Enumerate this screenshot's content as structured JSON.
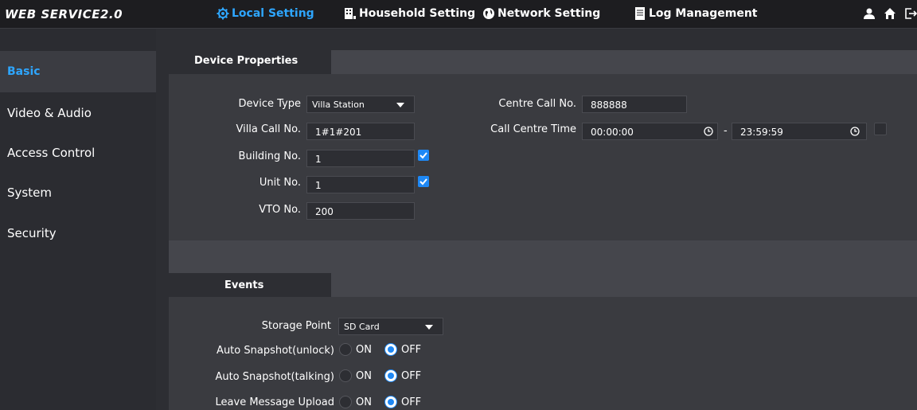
{
  "app": {
    "title": "WEB SERVICE2.0"
  },
  "nav": {
    "items": [
      {
        "label": "Local Setting",
        "icon": "gear-icon",
        "active": true
      },
      {
        "label": "Household Setting",
        "icon": "household-icon",
        "active": false
      },
      {
        "label": "Network Setting",
        "icon": "globe-icon",
        "active": false
      },
      {
        "label": "Log Management",
        "icon": "log-icon",
        "active": false
      }
    ],
    "right_icons": [
      "user-icon",
      "home-icon",
      "logout-icon"
    ]
  },
  "sidebar": {
    "items": [
      {
        "label": "Basic",
        "active": true
      },
      {
        "label": "Video & Audio",
        "active": false
      },
      {
        "label": "Access Control",
        "active": false
      },
      {
        "label": "System",
        "active": false
      },
      {
        "label": "Security",
        "active": false
      }
    ]
  },
  "device_properties": {
    "tab_label": "Device Properties",
    "device_type": {
      "label": "Device Type",
      "value": "Villa Station"
    },
    "villa_call_no": {
      "label": "Villa Call No.",
      "value": "1#1#201"
    },
    "building_no": {
      "label": "Building No.",
      "value": "1",
      "checked": true
    },
    "unit_no": {
      "label": "Unit No.",
      "value": "1",
      "checked": true
    },
    "vto_no": {
      "label": "VTO No.",
      "value": "200"
    },
    "centre_call_no": {
      "label": "Centre Call No.",
      "value": "888888"
    },
    "call_centre_time": {
      "label": "Call Centre Time",
      "start": "00:00:00",
      "separator": "-",
      "end": "23:59:59",
      "checked": false
    }
  },
  "events": {
    "tab_label": "Events",
    "storage_point": {
      "label": "Storage Point",
      "value": "SD Card"
    },
    "on_label": "ON",
    "off_label": "OFF",
    "rows": [
      {
        "label": "Auto Snapshot(unlock)",
        "value": "OFF"
      },
      {
        "label": "Auto Snapshot(talking)",
        "value": "OFF"
      },
      {
        "label": "Leave Message Upload",
        "value": "OFF"
      }
    ]
  },
  "colors": {
    "accent": "#2ea6ff",
    "checkbox": "#1e88f5",
    "background": "#2d2e33",
    "panel": "#3a3b40"
  }
}
